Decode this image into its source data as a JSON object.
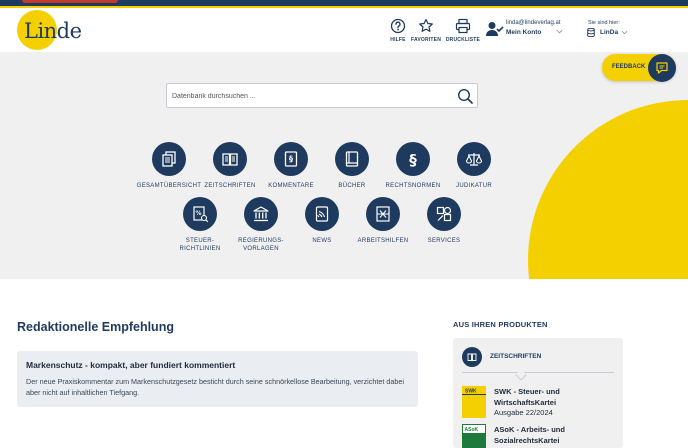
{
  "colors": {
    "navy": "#1f3a5f",
    "yellow": "#f5d000",
    "grey_bg": "#f0f0f1",
    "card_bg": "#eaeef2"
  },
  "header": {
    "logo_text": "Linde",
    "buttons": [
      {
        "label": "HILFE",
        "icon": "help-icon"
      },
      {
        "label": "FAVORITEN",
        "icon": "star-icon"
      },
      {
        "label": "DRUCKLISTE",
        "icon": "printer-icon"
      }
    ],
    "account": {
      "email": "linda@lindeverlag.at",
      "label": "Mein Konto",
      "icon": "user-check-icon"
    },
    "site": {
      "prefix": "Sie sind hier:",
      "name": "LinDa",
      "icon": "database-icon"
    }
  },
  "feedback": {
    "label": "FEEDBACK",
    "icon": "chat-icon"
  },
  "search": {
    "placeholder": "Datenbank durchsuchen ...",
    "value": "",
    "icon": "search-icon"
  },
  "tiles_row1": [
    {
      "label": "GESAMTÜBERSICHT",
      "icon": "documents-icon"
    },
    {
      "label": "ZEITSCHRIFTEN",
      "icon": "magazine-icon"
    },
    {
      "label": "KOMMENTARE",
      "icon": "commentary-book-icon"
    },
    {
      "label": "BÜCHER",
      "icon": "book-icon"
    },
    {
      "label": "RECHTSNORMEN",
      "icon": "paragraph-icon"
    },
    {
      "label": "JUDIKATUR",
      "icon": "scales-icon"
    }
  ],
  "tiles_row2": [
    {
      "label": "STEUER-\nRICHTLINIEN",
      "icon": "tax-guideline-icon"
    },
    {
      "label": "REGIERUNGS-\nVORLAGEN",
      "icon": "government-building-icon"
    },
    {
      "label": "NEWS",
      "icon": "news-icon"
    },
    {
      "label": "ARBEITSHILFEN",
      "icon": "worksheet-icon"
    },
    {
      "label": "SERVICES",
      "icon": "services-icon"
    }
  ],
  "recommendation": {
    "title": "Redaktionelle Empfehlung",
    "card_title": "Markenschutz - kompakt, aber fundiert kommentiert",
    "card_text": "Der neue Praxiskommentar zum Markenschutzgesetz besticht durch seine schnörkellose Bearbeitung, verzichtet dabei aber nicht auf inhaltlichen Tiefgang."
  },
  "products": {
    "title": "AUS IHREN PRODUKTEN",
    "category": "ZEITSCHRIFTEN",
    "items": [
      {
        "name": "SWK - Steuer- und WirtschaftsKartei",
        "issue": "Ausgabe 22/2024",
        "thumb_text": "SWK",
        "thumb_color": "#f5d000"
      },
      {
        "name": "ASoK - Arbeits- und SozialrechtsKartei",
        "issue": "",
        "thumb_text": "ASoK",
        "thumb_color": "#1e7a3c"
      }
    ]
  }
}
